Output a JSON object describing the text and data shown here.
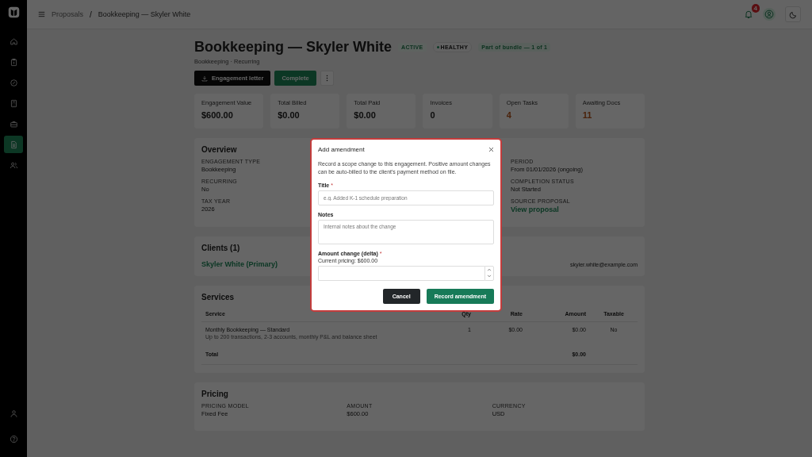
{
  "sidebar": {
    "items": [
      {
        "kind": "home",
        "selected": false
      },
      {
        "kind": "clipboard",
        "selected": false
      },
      {
        "kind": "gauge",
        "selected": false
      },
      {
        "kind": "calculator",
        "selected": false
      },
      {
        "kind": "briefcase",
        "selected": false
      },
      {
        "kind": "document",
        "selected": true
      },
      {
        "kind": "users",
        "selected": false
      }
    ],
    "bottom_items": [
      {
        "kind": "user"
      },
      {
        "kind": "help"
      }
    ]
  },
  "topbar": {
    "breadcrumbs": [
      "Proposals",
      "Bookkeeping — Skyler White"
    ],
    "separator": "/",
    "notification_count": "4"
  },
  "header": {
    "title": "Bookkeeping — Skyler White",
    "badges": [
      {
        "kind": "status",
        "label": "ACTIVE"
      },
      {
        "kind": "health",
        "label": "HEALTHY"
      },
      {
        "kind": "bundle",
        "label": "Part of bundle — 1 of 1"
      }
    ],
    "subtitle": "Bookkeeping · Recurring",
    "actions": [
      {
        "kind": "download",
        "label": "Engagement letter"
      },
      {
        "kind": "primary",
        "label": "Complete"
      },
      {
        "kind": "more"
      }
    ]
  },
  "stats": [
    {
      "label": "Engagement Value",
      "value": "$600.00",
      "highlight": false
    },
    {
      "label": "Total Billed",
      "value": "$0.00",
      "highlight": false
    },
    {
      "label": "Total Paid",
      "value": "$0.00",
      "highlight": false
    },
    {
      "label": "Invoices",
      "value": "0",
      "highlight": false
    },
    {
      "label": "Open Tasks",
      "value": "4",
      "highlight": true
    },
    {
      "label": "Awaiting Docs",
      "value": "11",
      "highlight": true
    }
  ],
  "overview": {
    "title": "Overview",
    "columns": [
      [
        {
          "label": "ENGAGEMENT TYPE",
          "value": "Bookkeeping",
          "kind": "text"
        },
        {
          "label": "RECURRING",
          "value": "No",
          "kind": "text"
        },
        {
          "label": "TAX YEAR",
          "value": "2026",
          "kind": "text"
        }
      ],
      [
        {
          "label": "PERIOD",
          "value": "From 01/01/2026 (ongoing)",
          "kind": "text"
        },
        {
          "label": "COMPLETION STATUS",
          "value": "Not Started",
          "kind": "text"
        },
        {
          "label": "SOURCE PROPOSAL",
          "value": "View proposal",
          "kind": "link"
        }
      ]
    ]
  },
  "clients": {
    "title": "Clients (1)",
    "items": [
      {
        "name": "Skyler White (Primary)",
        "email": "skyler.white@example.com"
      }
    ]
  },
  "services": {
    "title": "Services",
    "columns": [
      "Service",
      "Qty",
      "Rate",
      "Amount",
      "Taxable"
    ],
    "rows": [
      {
        "name": "Monthly Bookkeeping — Standard",
        "description": "Up to 200 transactions, 2-3 accounts, monthly P&L and balance sheet",
        "qty": "1",
        "rate": "$0.00",
        "amount": "$0.00",
        "taxable": "No"
      }
    ],
    "total_label": "Total",
    "total_amount": "$0.00"
  },
  "pricing": {
    "title": "Pricing",
    "fields": [
      {
        "label": "PRICING MODEL",
        "value": "Fixed Fee"
      },
      {
        "label": "AMOUNT",
        "value": "$600.00"
      },
      {
        "label": "CURRENCY",
        "value": "USD"
      }
    ]
  },
  "modal": {
    "title": "Add amendment",
    "description": "Record a scope change to this engagement. Positive amount changes can be auto-billed to the client's payment method on file.",
    "fields": [
      {
        "kind": "input",
        "label": "Title",
        "required_mark": "*",
        "placeholder": "e.g. Added K-1 schedule preparation"
      },
      {
        "kind": "textarea",
        "label": "Notes",
        "placeholder": "Internal notes about the change"
      },
      {
        "kind": "number",
        "label": "Amount change (delta)",
        "required_mark": "*",
        "hint": "Current pricing: $600.00"
      }
    ],
    "buttons": [
      {
        "kind": "secondary",
        "label": "Cancel"
      },
      {
        "kind": "primary",
        "label": "Record amendment"
      }
    ]
  }
}
